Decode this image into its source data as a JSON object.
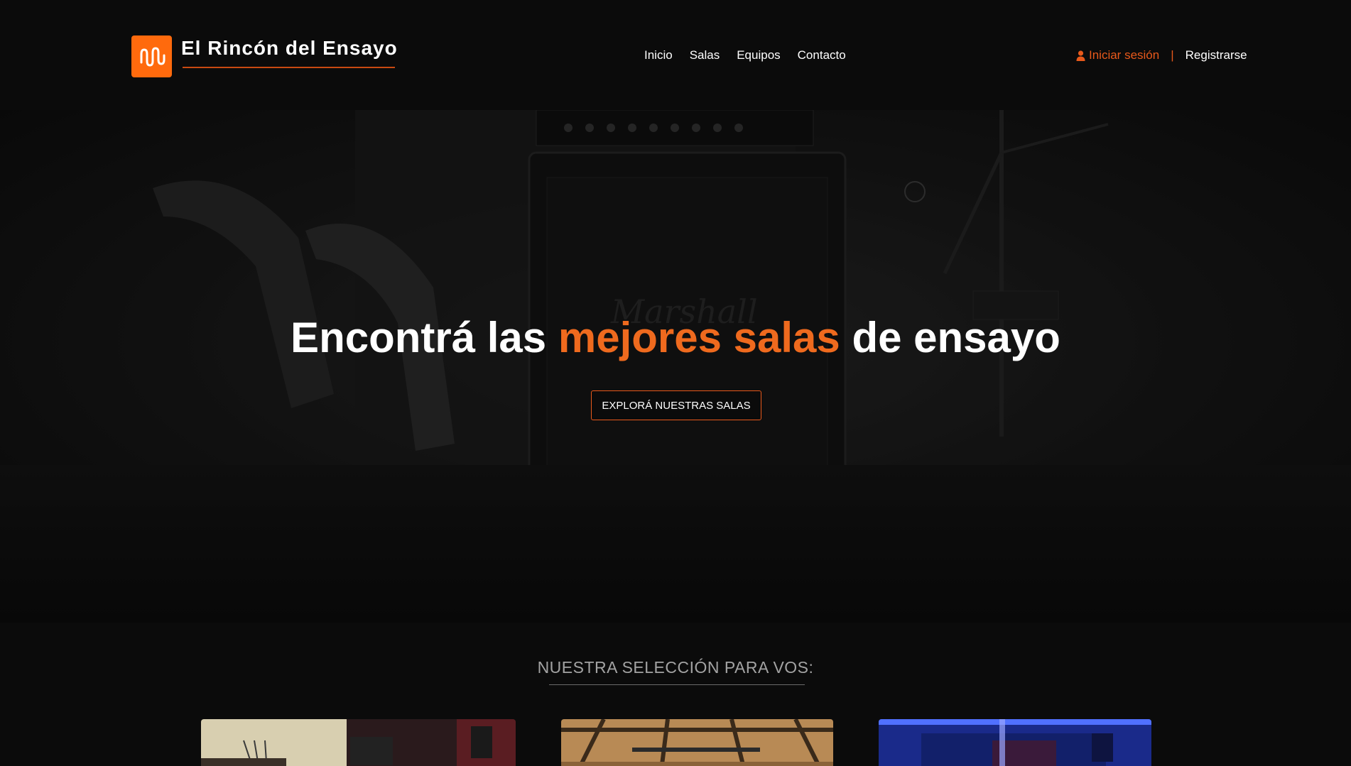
{
  "brand": {
    "name": "El Rincón del Ensayo",
    "accent_color": "#ff6a0d",
    "logo_icon": "sound-wave-icon"
  },
  "nav": {
    "items": [
      {
        "label": "Inicio"
      },
      {
        "label": "Salas"
      },
      {
        "label": "Equipos"
      },
      {
        "label": "Contacto"
      }
    ]
  },
  "auth": {
    "login_label": "Iniciar sesión",
    "login_icon": "user-icon",
    "separator": "|",
    "register_label": "Registrarse"
  },
  "hero": {
    "title_before": "Encontrá las ",
    "title_accent": "mejores salas",
    "title_after": " de ensayo",
    "cta_label": "EXPLORÁ NUESTRAS SALAS"
  },
  "selection": {
    "title": "NUESTRA SELECCIÓN PARA VOS:",
    "cards": [
      {
        "image": "rehearsal-room-red-photo"
      },
      {
        "image": "rehearsal-room-wood-ceiling-photo"
      },
      {
        "image": "rehearsal-room-blue-light-photo"
      }
    ]
  }
}
